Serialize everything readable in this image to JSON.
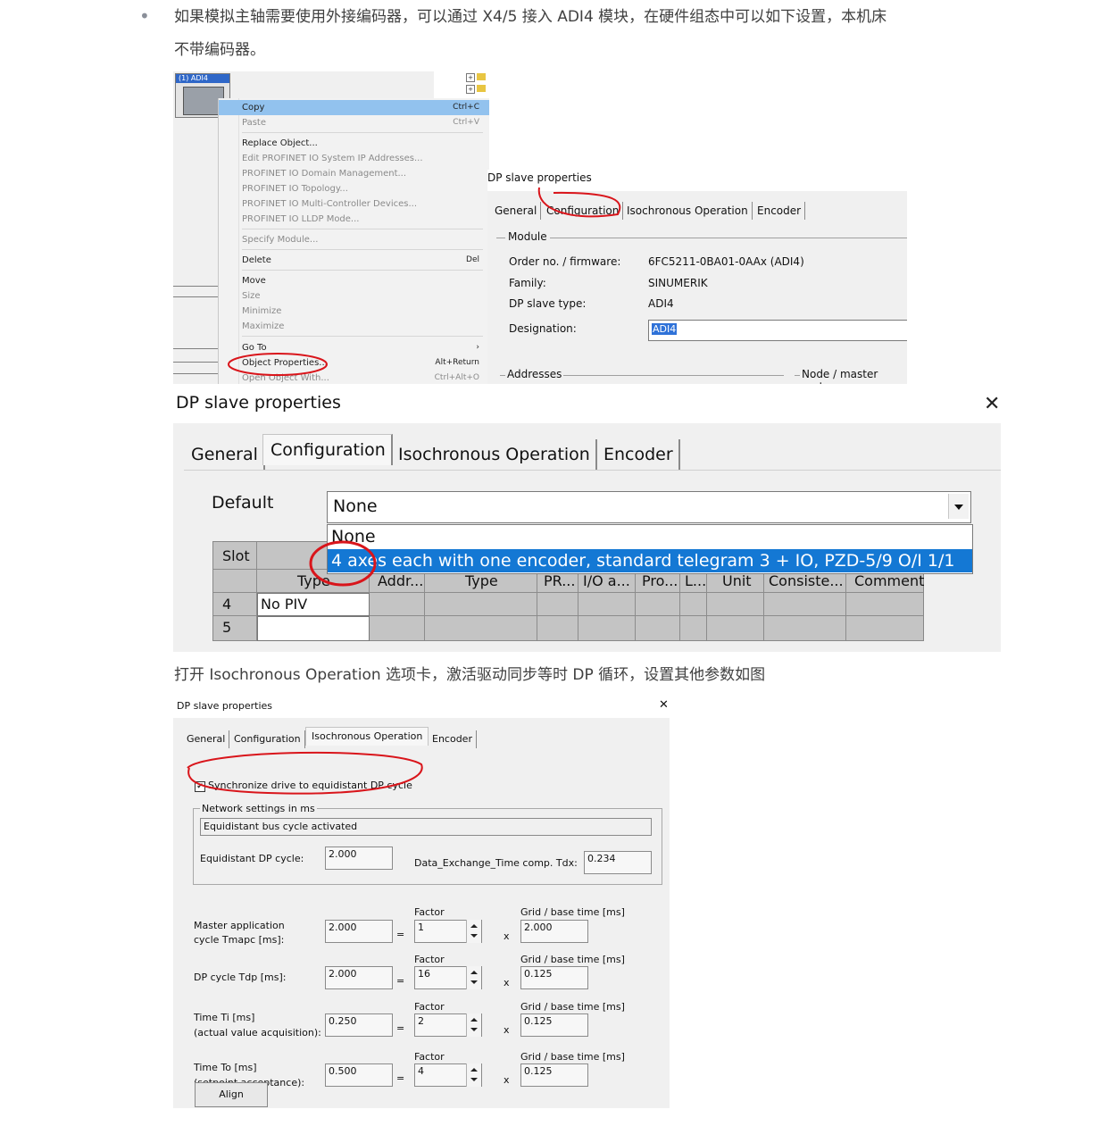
{
  "intro": {
    "line1": "如果模拟主轴需要使用外接编码器，可以通过 X4/5 接入 ADI4 模块，在硬件组态中可以如下设置，本机床",
    "line2": "不带编码器。"
  },
  "device": {
    "caption": "(1) ADI4"
  },
  "context_menu": {
    "items": [
      {
        "label": "Copy",
        "shortcut": "Ctrl+C"
      },
      {
        "label": "Paste",
        "shortcut": "Ctrl+V"
      },
      {
        "label": "Replace Object..."
      },
      {
        "label": "Edit PROFINET IO System IP Addresses..."
      },
      {
        "label": "PROFINET IO Domain Management..."
      },
      {
        "label": "PROFINET IO Topology..."
      },
      {
        "label": "PROFINET IO Multi-Controller Devices..."
      },
      {
        "label": "PROFINET IO LLDP Mode..."
      },
      {
        "label": "Specify Module..."
      },
      {
        "label": "Delete",
        "shortcut": "Del"
      },
      {
        "label": "Move"
      },
      {
        "label": "Size"
      },
      {
        "label": "Minimize"
      },
      {
        "label": "Maximize"
      },
      {
        "label": "Go To",
        "shortcut": "›"
      },
      {
        "label": "Object Properties...",
        "shortcut": "Alt+Return"
      },
      {
        "label": "Open Object With...",
        "shortcut": "Ctrl+Alt+O"
      }
    ]
  },
  "small_dialog": {
    "title": "DP slave properties",
    "tabs": [
      "General",
      "Configuration",
      "Isochronous Operation",
      "Encoder"
    ],
    "module_group": "Module",
    "rows": [
      {
        "label": "Order no. / firmware:",
        "value": "6FC5211-0BA01-0AAx (ADI4)"
      },
      {
        "label": "Family:",
        "value": "SINUMERIK"
      },
      {
        "label": "DP slave type:",
        "value": "ADI4"
      },
      {
        "label": "Designation:",
        "value": "ADI4"
      }
    ],
    "addresses_group": "Addresses",
    "node_group": "Node / master syste"
  },
  "config_dialog": {
    "title": "DP slave properties",
    "close": "✕",
    "tabs": [
      "General",
      "Configuration",
      "Isochronous Operation",
      "Encoder"
    ],
    "default_label": "Default",
    "default_value": "None",
    "options": [
      "None",
      "4 axes each with one encoder, standard telegram 3 + IO, PZD-5/9 O/I 1/1"
    ],
    "columns": [
      "Slot",
      "Type",
      "Addr...",
      "Type",
      "PR...",
      "I/O a...",
      "Pro...",
      "L...",
      "Unit",
      "Consiste...",
      "Comment"
    ],
    "rows": [
      {
        "slot": "4",
        "type": "No PIV"
      },
      {
        "slot": "5",
        "type": ""
      }
    ]
  },
  "caption2": "打开 Isochronous Operation 选项卡，激活驱动同步等时 DP 循环，设置其他参数如图",
  "iso_dialog": {
    "title": "DP slave properties",
    "close": "✕",
    "tabs": [
      "General",
      "Configuration",
      "Isochronous Operation",
      "Encoder"
    ],
    "sync_checkbox": "Synchronize drive to equidistant DP cycle",
    "network_group": "Network settings in ms",
    "bus_status": "Equidistant bus cycle activated",
    "equidistant_label": "Equidistant DP cycle:",
    "equidistant_value": "2.000",
    "tdx_label": "Data_Exchange_Time comp. Tdx:",
    "tdx_value": "0.234",
    "factor_label": "Factor",
    "grid_label": "Grid / base time [ms]",
    "eq": "=",
    "times": "x",
    "params": [
      {
        "label1": "Master application",
        "label2": "cycle Tmapc [ms]:",
        "value": "2.000",
        "factor": "1",
        "grid": "2.000"
      },
      {
        "label1": "DP cycle Tdp [ms]:",
        "label2": "",
        "value": "2.000",
        "factor": "16",
        "grid": "0.125"
      },
      {
        "label1": "Time Ti  [ms]",
        "label2": "(actual value acquisition):",
        "value": "0.250",
        "factor": "2",
        "grid": "0.125"
      },
      {
        "label1": "Time To  [ms]",
        "label2": "(setpoint acceptance):",
        "value": "0.500",
        "factor": "4",
        "grid": "0.125"
      }
    ],
    "align_button": "Align"
  },
  "annotation_color": "#d9151b"
}
